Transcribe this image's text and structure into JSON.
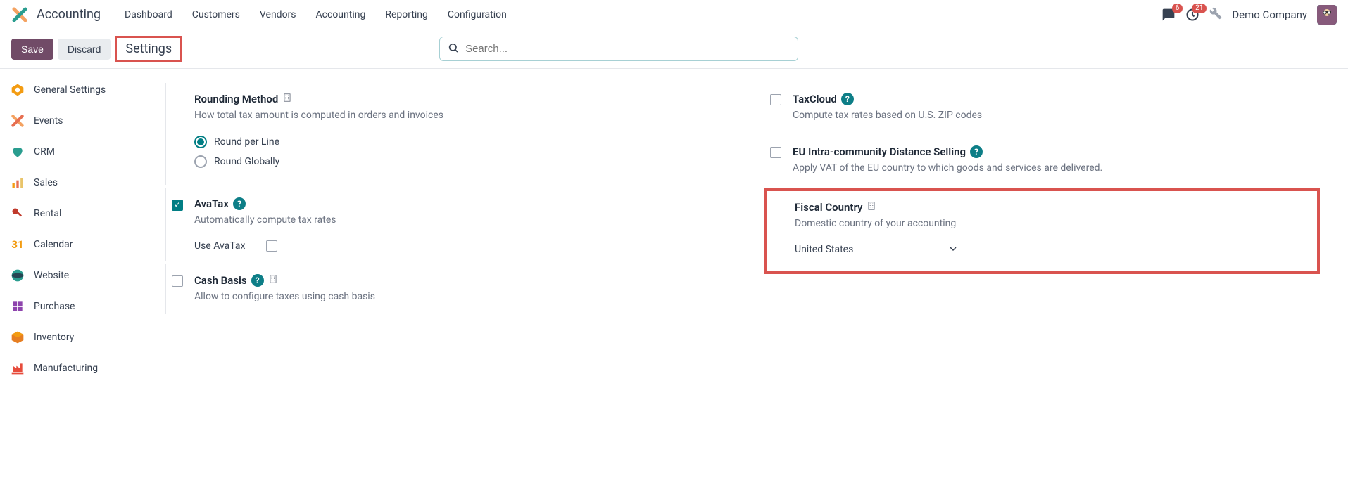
{
  "topbar": {
    "app_name": "Accounting",
    "menu": [
      "Dashboard",
      "Customers",
      "Vendors",
      "Accounting",
      "Reporting",
      "Configuration"
    ],
    "messages_count": "6",
    "activities_count": "21",
    "company": "Demo Company"
  },
  "actionbar": {
    "save": "Save",
    "discard": "Discard",
    "breadcrumb": "Settings",
    "search_placeholder": "Search..."
  },
  "sidebar": {
    "items": [
      {
        "label": "General Settings"
      },
      {
        "label": "Events"
      },
      {
        "label": "CRM"
      },
      {
        "label": "Sales"
      },
      {
        "label": "Rental"
      },
      {
        "label": "Calendar"
      },
      {
        "label": "Website"
      },
      {
        "label": "Purchase"
      },
      {
        "label": "Inventory"
      },
      {
        "label": "Manufacturing"
      }
    ]
  },
  "settings": {
    "rounding": {
      "title": "Rounding Method",
      "desc": "How total tax amount is computed in orders and invoices",
      "opt1": "Round per Line",
      "opt2": "Round Globally"
    },
    "taxcloud": {
      "title": "TaxCloud",
      "desc": "Compute tax rates based on U.S. ZIP codes"
    },
    "avatax": {
      "title": "AvaTax",
      "desc": "Automatically compute tax rates",
      "use_label": "Use AvaTax"
    },
    "eu": {
      "title": "EU Intra-community Distance Selling",
      "desc": "Apply VAT of the EU country to which goods and services are delivered."
    },
    "cashbasis": {
      "title": "Cash Basis",
      "desc": "Allow to configure taxes using cash basis"
    },
    "fiscal": {
      "title": "Fiscal Country",
      "desc": "Domestic country of your accounting",
      "value": "United States"
    }
  }
}
